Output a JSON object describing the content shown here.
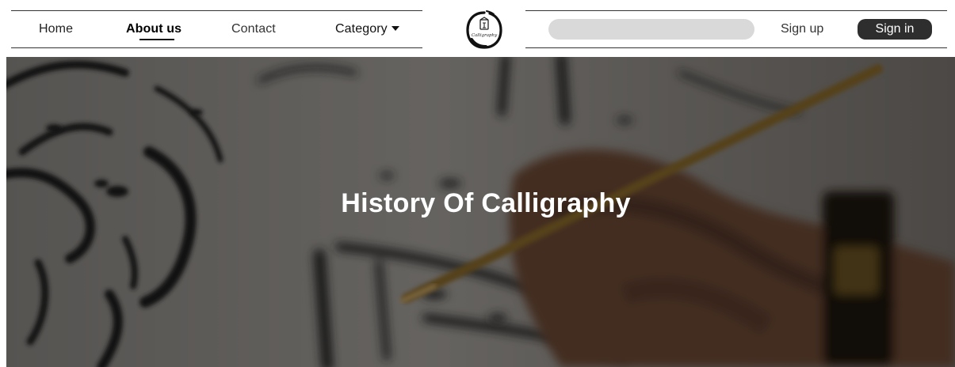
{
  "nav": {
    "links": [
      {
        "label": "Home"
      },
      {
        "label": "About us",
        "active": true
      },
      {
        "label": "Contact"
      },
      {
        "label": "Category"
      }
    ],
    "logo_icon": "calligraphy-logo-icon",
    "logo_text": "Calligraphy",
    "search": {
      "value": "",
      "placeholder": ""
    },
    "signup_label": "Sign up",
    "signin_label": "Sign in"
  },
  "hero": {
    "title": "History Of Calligraphy",
    "background": "calligraphy-writing-photo"
  },
  "colors": {
    "accent_dark": "#2e2e2e",
    "search_bg": "#d9d9d9",
    "hero_text": "#ffffff"
  }
}
